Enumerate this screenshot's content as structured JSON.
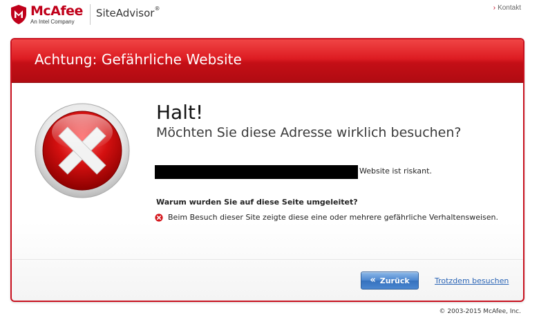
{
  "header": {
    "brand": "McAfee",
    "brand_sub": "An Intel Company",
    "product": "SiteAdvisor",
    "product_mark": "®",
    "contact_link": "Kontakt"
  },
  "dialog": {
    "title": "Achtung: Gefährliche Website",
    "headline": "Halt!",
    "question": "Möchten Sie diese Adresse wirklich besuchen?",
    "risky_suffix": "Website ist riskant.",
    "why_heading": "Warum wurden Sie auf diese Seite umgeleitet?",
    "reason": "Beim Besuch dieser Site zeigte diese eine oder mehrere gefährliche Verhaltensweisen.",
    "back_button": "Zurück",
    "proceed_link": "Trotzdem besuchen"
  },
  "footer": {
    "copyright": "© 2003-2015 McAfee, Inc."
  },
  "icons": {
    "brand_logo": "mcafee-shield-icon",
    "error": "red-x-error-icon",
    "reason": "small-red-x-icon",
    "back": "double-chevron-left-icon",
    "contact": "chevron-right-icon"
  },
  "colors": {
    "brand_red": "#c0001a",
    "header_red": "#dd1c22",
    "button_blue": "#4a86d0",
    "link_blue": "#2a64b5"
  }
}
